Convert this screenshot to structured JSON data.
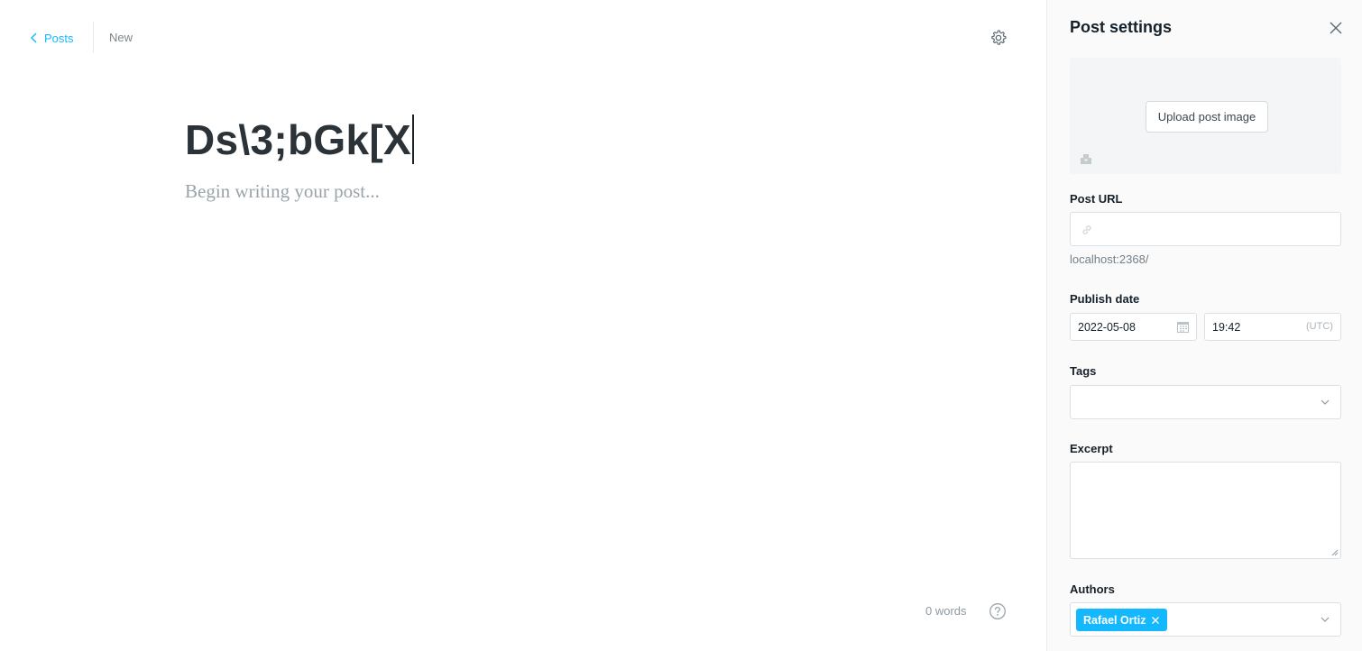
{
  "header": {
    "back_label": "Posts",
    "status": "New"
  },
  "editor": {
    "title": "Ds\\3;bGk[X",
    "body_placeholder": "Begin writing your post...",
    "word_count": "0 words"
  },
  "settings": {
    "title": "Post settings",
    "upload_label": "Upload post image",
    "post_url_label": "Post URL",
    "post_url_value": "",
    "post_url_hint": "localhost:2368/",
    "publish_date_label": "Publish date",
    "publish_date": "2022-05-08",
    "publish_time": "19:42",
    "timezone": "(UTC)",
    "tags_label": "Tags",
    "excerpt_label": "Excerpt",
    "excerpt_value": "",
    "authors_label": "Authors",
    "authors": [
      "Rafael Ortiz"
    ]
  },
  "colors": {
    "accent": "#14b8ff",
    "title_text": "#2b3338",
    "panel_bg": "#fafafb"
  },
  "icons": {
    "back": "chevron-left-icon",
    "settings": "gear-icon",
    "help": "question-circle-icon",
    "close": "close-icon",
    "image": "image-icon",
    "link": "link-icon",
    "calendar": "calendar-icon",
    "dropdown": "chevron-down-icon",
    "remove": "x-icon"
  }
}
